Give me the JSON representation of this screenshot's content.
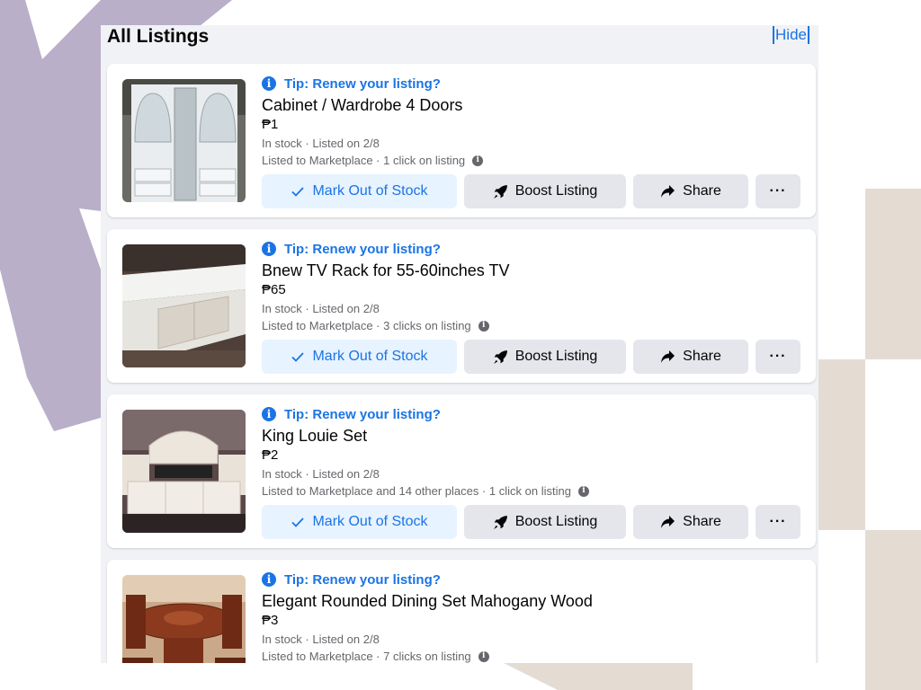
{
  "page": {
    "title": "All Listings",
    "hide_label": "Hide"
  },
  "colors": {
    "accent": "#1b74e4",
    "accent_light": "#e7f3ff",
    "button_grey": "#e4e6eb",
    "panel_bg": "#f0f2f5",
    "deco_purple": "#b9afc9",
    "deco_beige": "#e4dcd3"
  },
  "actions": {
    "mark_out_of_stock": "Mark Out of Stock",
    "boost_listing": "Boost Listing",
    "share": "Share",
    "more": "···"
  },
  "icons": {
    "tip": "info-circle-icon",
    "meta_info": "info-dot-icon",
    "mark": "checkmark-icon",
    "boost": "rocket-icon",
    "share": "share-arrow-icon",
    "more": "ellipsis-icon"
  },
  "listings": [
    {
      "tip": "Tip: Renew your listing?",
      "title": "Cabinet / Wardrobe 4 Doors",
      "price": "₱1",
      "status": "In stock · Listed on 2/8",
      "stats": "Listed to Marketplace · 1 click on listing"
    },
    {
      "tip": "Tip: Renew your listing?",
      "title": "Bnew TV Rack for 55-60inches TV",
      "price": "₱65",
      "status": "In stock · Listed on 2/8",
      "stats": "Listed to Marketplace · 3 clicks on listing"
    },
    {
      "tip": "Tip: Renew your listing?",
      "title": "King Louie Set",
      "price": "₱2",
      "status": "In stock · Listed on 2/8",
      "stats": "Listed to Marketplace and 14 other places · 1 click on listing"
    },
    {
      "tip": "Tip: Renew your listing?",
      "title": "Elegant Rounded Dining Set Mahogany Wood",
      "price": "₱3",
      "status": "In stock · Listed on 2/8",
      "stats": "Listed to Marketplace · 7 clicks on listing"
    }
  ]
}
